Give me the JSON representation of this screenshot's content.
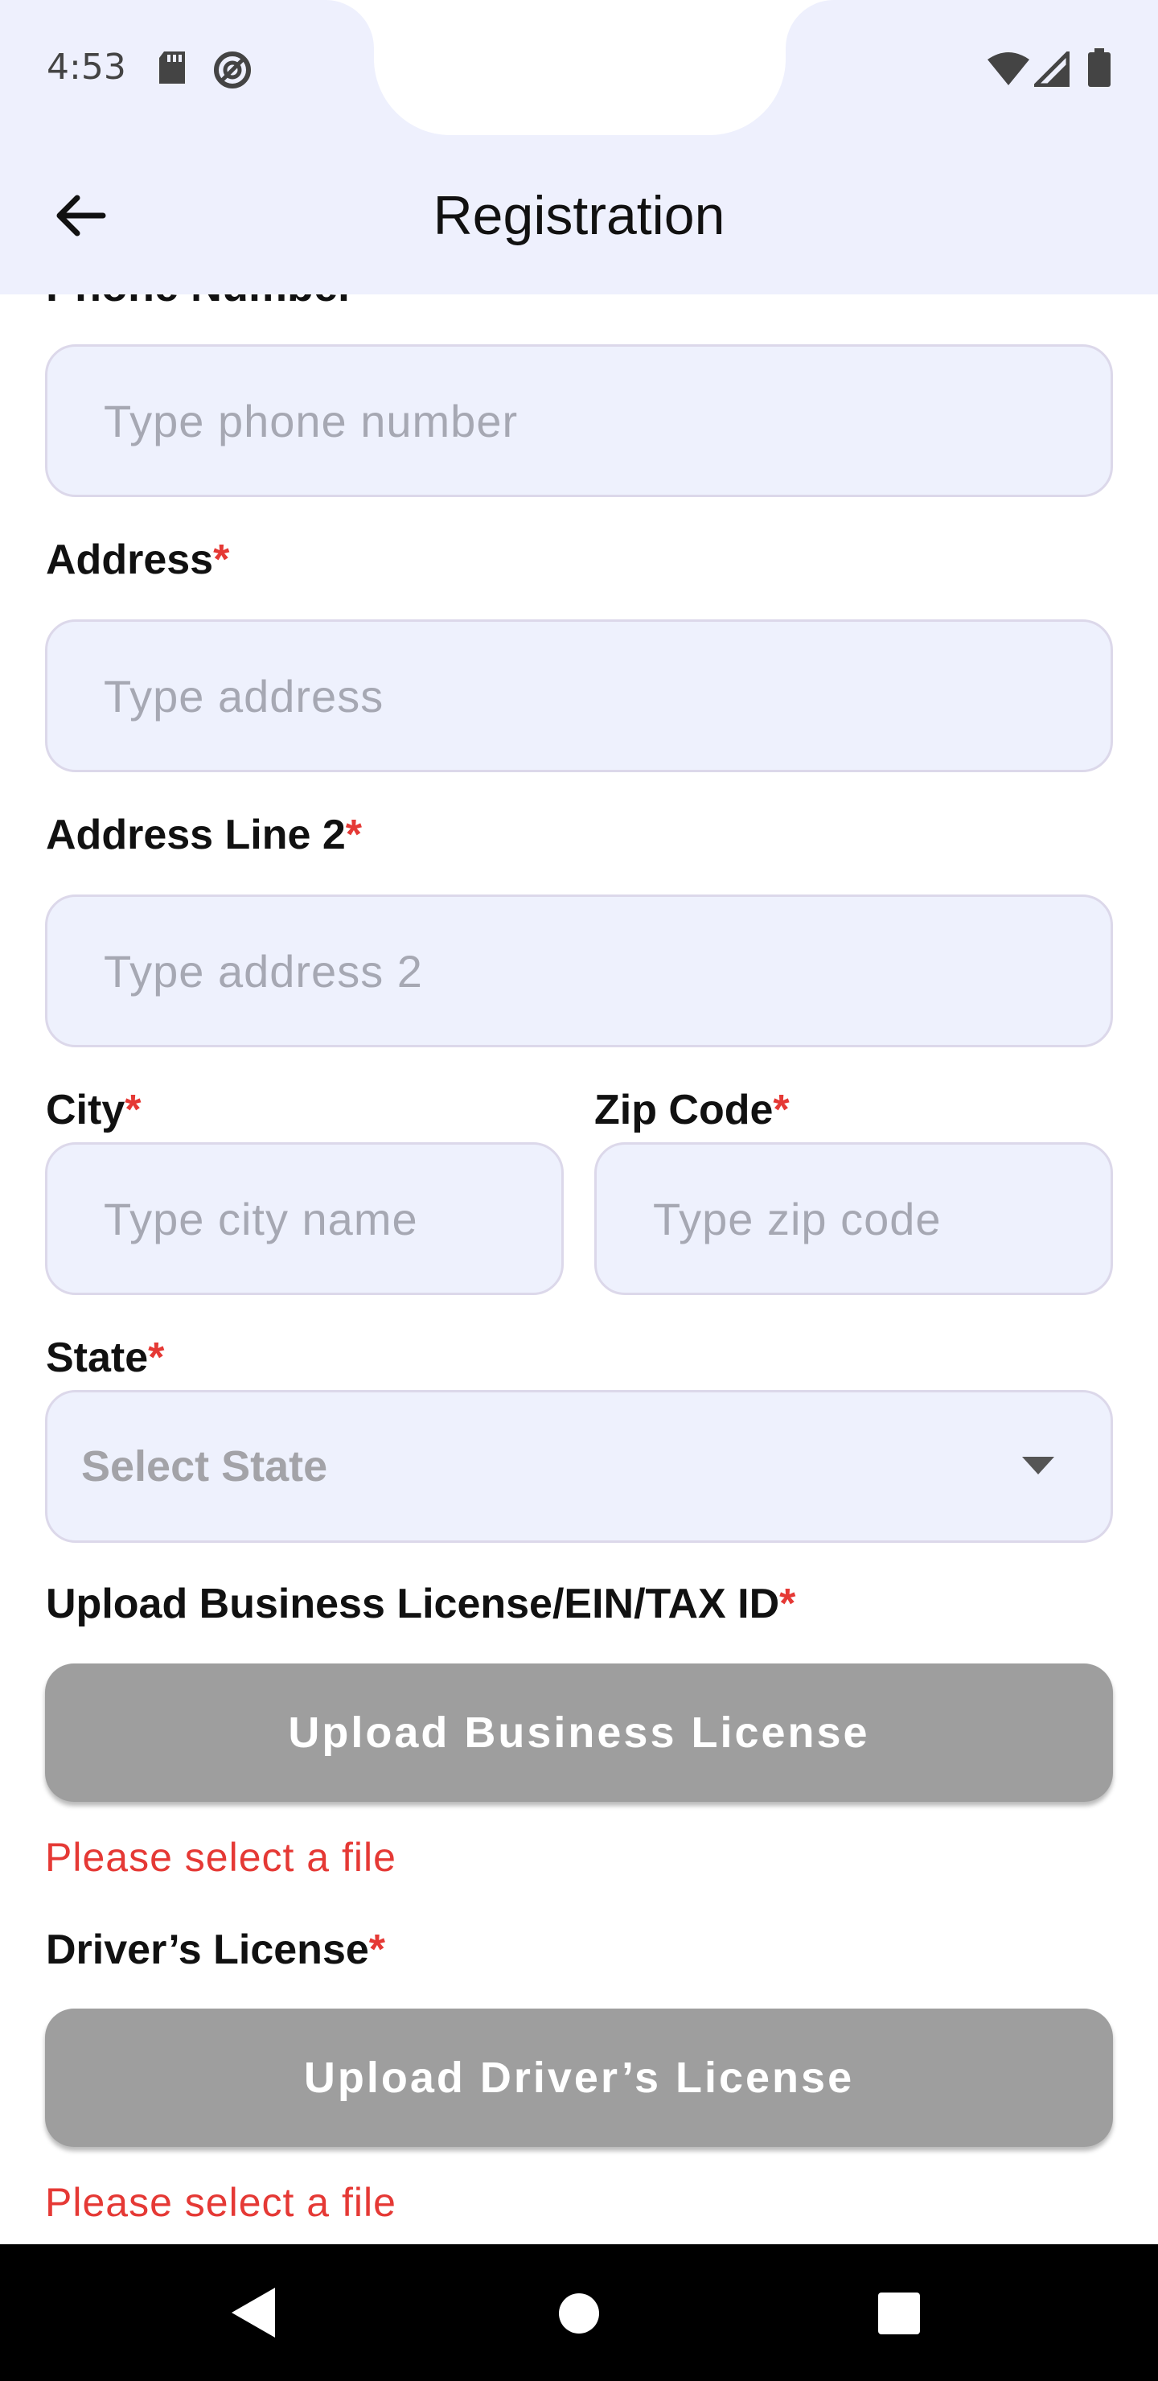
{
  "status_bar": {
    "time": "4:53",
    "left_icons": [
      "sd-card-icon",
      "at-sign-icon"
    ],
    "right_icons": [
      "wifi-icon",
      "signal-icon",
      "battery-icon"
    ]
  },
  "app_bar": {
    "title": "Registration",
    "back_icon": "arrow-left-icon"
  },
  "form": {
    "clipped_label": "Phone Number",
    "phone": {
      "placeholder": "Type phone number"
    },
    "address": {
      "label": "Address",
      "required": "*",
      "placeholder": "Type address"
    },
    "address2": {
      "label": "Address Line 2",
      "required": "*",
      "placeholder": "Type address 2"
    },
    "city": {
      "label": "City",
      "required": "*",
      "placeholder": "Type city name"
    },
    "zip": {
      "label": "Zip Code",
      "required": "*",
      "placeholder": "Type zip code"
    },
    "state": {
      "label": "State",
      "required": "*",
      "value": "Select State"
    },
    "business_license": {
      "label": "Upload Business License/EIN/TAX ID",
      "required": "*",
      "button": "Upload Business License",
      "error": "Please select a file"
    },
    "drivers_license": {
      "label": "Driver’s License",
      "required": "*",
      "button": "Upload Driver’s License",
      "error": "Please select a file"
    }
  },
  "nav_bar": {
    "buttons": [
      "back-triangle-icon",
      "home-circle-icon",
      "recents-square-icon"
    ]
  },
  "colors": {
    "accent_bg": "#eef0fd",
    "required": "#e53935",
    "button_gray": "#9e9e9e"
  }
}
